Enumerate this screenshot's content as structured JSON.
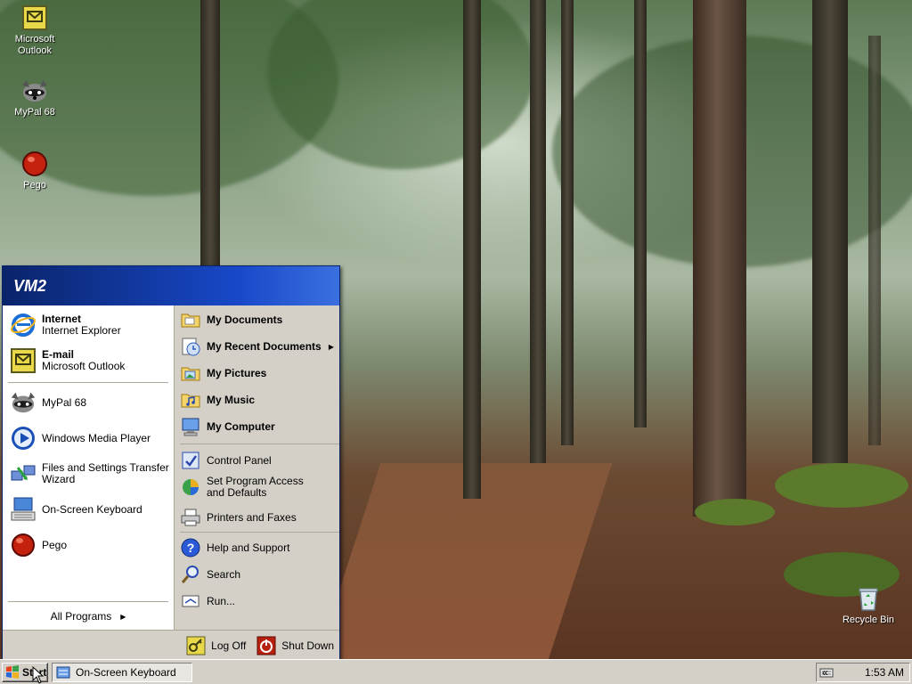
{
  "desktop": {
    "icons": [
      {
        "label": "Microsoft Outlook",
        "icon": "outlook-icon"
      },
      {
        "label": "MyPal 68",
        "icon": "mypal-raccoon-icon"
      },
      {
        "label": "Pego",
        "icon": "pego-icon"
      },
      {
        "label": "Recycle Bin",
        "icon": "recycle-bin-icon"
      }
    ]
  },
  "start_menu": {
    "user": "VM2",
    "pinned": [
      {
        "title": "Internet",
        "subtitle": "Internet Explorer",
        "icon": "internet-explorer-icon"
      },
      {
        "title": "E-mail",
        "subtitle": "Microsoft Outlook",
        "icon": "outlook-icon"
      }
    ],
    "recent": [
      {
        "label": "MyPal 68",
        "icon": "mypal-raccoon-icon"
      },
      {
        "label": "Windows Media Player",
        "icon": "media-player-icon"
      },
      {
        "label": "Files and Settings Transfer Wizard",
        "icon": "transfer-wizard-icon"
      },
      {
        "label": "On-Screen Keyboard",
        "icon": "keyboard-icon"
      },
      {
        "label": "Pego",
        "icon": "pego-icon"
      }
    ],
    "all_programs": "All Programs",
    "right": {
      "my_documents": "My Documents",
      "my_recent_documents": "My Recent Documents",
      "my_pictures": "My Pictures",
      "my_music": "My Music",
      "my_computer": "My Computer",
      "control_panel": "Control Panel",
      "set_program_access": "Set Program Access and Defaults",
      "printers_faxes": "Printers and Faxes",
      "help_support": "Help and Support",
      "search": "Search",
      "run": "Run..."
    },
    "log_off": "Log Off",
    "shut_down": "Shut Down"
  },
  "taskbar": {
    "start_label": "Start",
    "task_osk": "On-Screen Keyboard",
    "tray_chevron": "«",
    "clock": "1:53 AM"
  },
  "colors": {
    "menu_header": "#0a246a",
    "menu_header_light": "#3a6fe0",
    "menu_right_panel": "#d4d0c8",
    "taskbar": "#d4d0c8"
  }
}
